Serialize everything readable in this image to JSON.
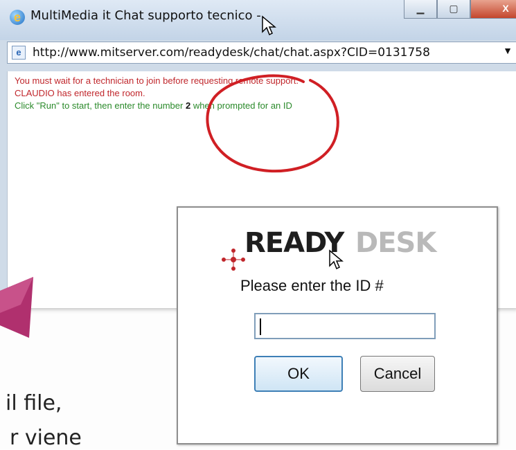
{
  "window": {
    "title": "MultiMedia it Chat supporto tecnico -",
    "controls": {
      "minimize": "▁",
      "maximize": "▢",
      "close": "X"
    },
    "address_bar": {
      "url": "http://www.mitserver.com/readydesk/chat/chat.aspx?CID=0131758",
      "dropdown": "▼"
    }
  },
  "chat": {
    "lines": [
      {
        "text": "You must wait for a technician to join before requesting remote support.",
        "color": "#c0262b"
      },
      {
        "text": "CLAUDIO has entered the room.",
        "color": "#c0262b"
      },
      {
        "text_before": "Click \"Run\" to start, then enter the number ",
        "number": "2",
        "text_after": " when prompted for an ID",
        "color": "#2b8a2b"
      }
    ]
  },
  "dialog": {
    "logo_ready": "READY",
    "logo_desk": "DESK",
    "prompt": "Please enter the ID #",
    "input_value": "",
    "ok_label": "OK",
    "cancel_label": "Cancel"
  },
  "slide": {
    "line1": "il file,",
    "line2": "r viene"
  },
  "colors": {
    "annotation": "#d01f24",
    "accent_pink": "#b0306e"
  }
}
